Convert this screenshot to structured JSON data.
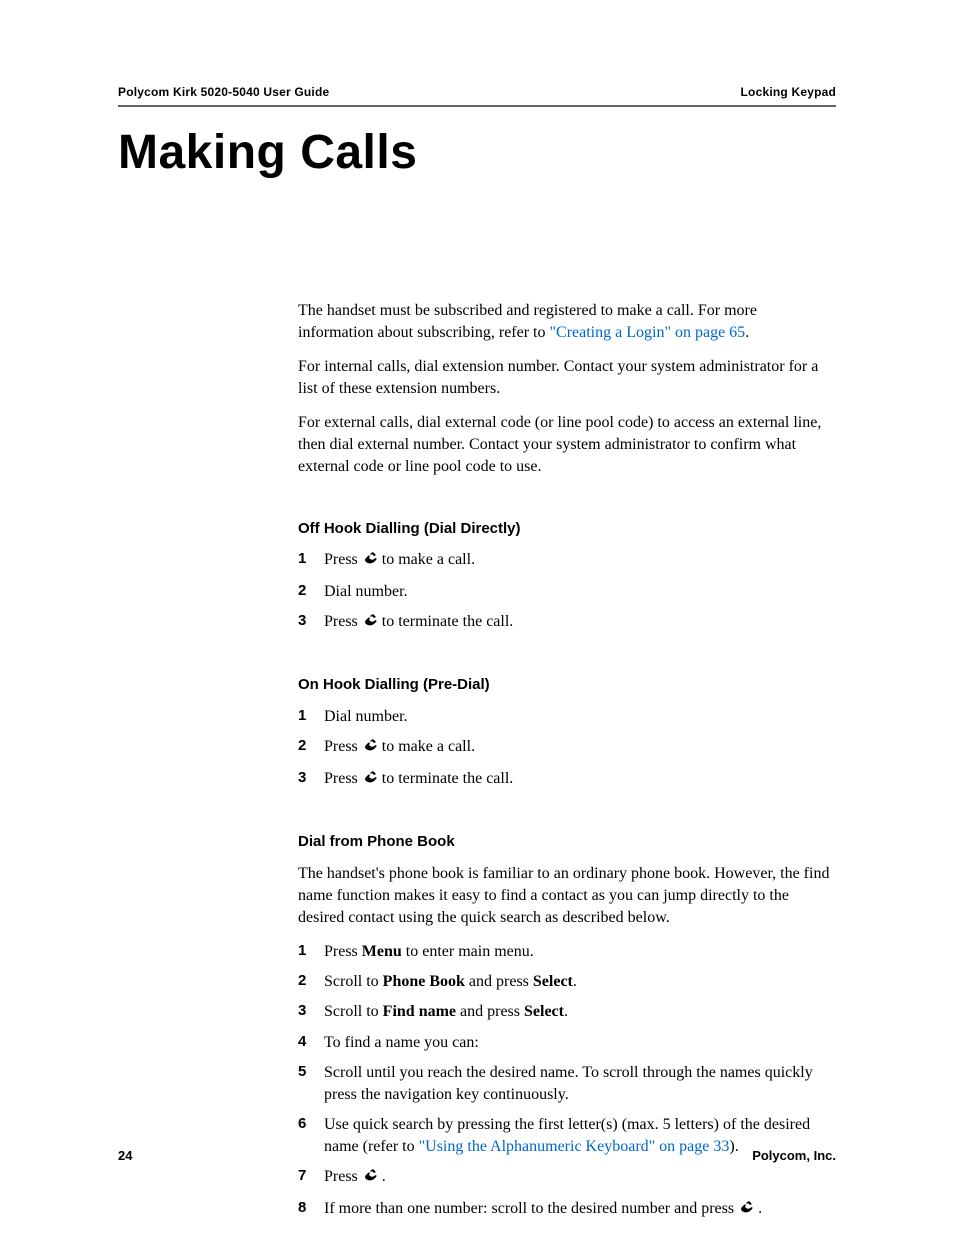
{
  "header": {
    "left": "Polycom Kirk 5020-5040 User Guide",
    "right": "Locking Keypad"
  },
  "title": "Making Calls",
  "intro": {
    "p1_a": "The handset must be subscribed and registered to make a call. For more information about subscribing, refer to ",
    "p1_link": "\"Creating a Login\" on page 65",
    "p1_b": ".",
    "p2": "For internal calls, dial extension number. Contact your system administrator for a list of these extension numbers.",
    "p3": "For external calls, dial external code (or line pool code) to access an external line, then dial external number. Contact your system administrator to confirm what external code or line pool code to use."
  },
  "off_hook": {
    "heading": "Off Hook Dialling (Dial Directly)",
    "s1_a": "Press ",
    "s1_b": " to make a call.",
    "s2": "Dial number.",
    "s3_a": "Press ",
    "s3_b": " to terminate the call."
  },
  "on_hook": {
    "heading": "On Hook Dialling (Pre-Dial)",
    "s1": "Dial number.",
    "s2_a": "Press ",
    "s2_b": " to make a call.",
    "s3_a": "Press ",
    "s3_b": " to terminate the call."
  },
  "phone_book": {
    "heading": "Dial from Phone Book",
    "intro": "The handset's phone book is familiar to an ordinary phone book. However, the find name function makes it easy to find a contact as you can jump directly to the desired contact using the quick search as described below.",
    "s1_a": "Press ",
    "s1_bold": "Menu",
    "s1_b": " to enter main menu.",
    "s2_a": "Scroll to ",
    "s2_bold": "Phone Book",
    "s2_b": " and press ",
    "s2_bold2": "Select",
    "s2_c": ".",
    "s3_a": "Scroll to ",
    "s3_bold": "Find name",
    "s3_b": " and press ",
    "s3_bold2": "Select",
    "s3_c": ".",
    "s4": "To find a name you can:",
    "s5": "Scroll until you reach the desired name. To scroll through the names quickly press the navigation key continuously.",
    "s6_a": "Use quick search by pressing the first letter(s) (max. 5 letters) of the desired name (refer to ",
    "s6_link": "\"Using the Alphanumeric Keyboard\" on page 33",
    "s6_b": ").",
    "s7_a": "Press ",
    "s7_b": " .",
    "s8_a": "If more than one number: scroll to the desired number and press ",
    "s8_b": " ."
  },
  "footer": {
    "page": "24",
    "company": "Polycom, Inc."
  }
}
